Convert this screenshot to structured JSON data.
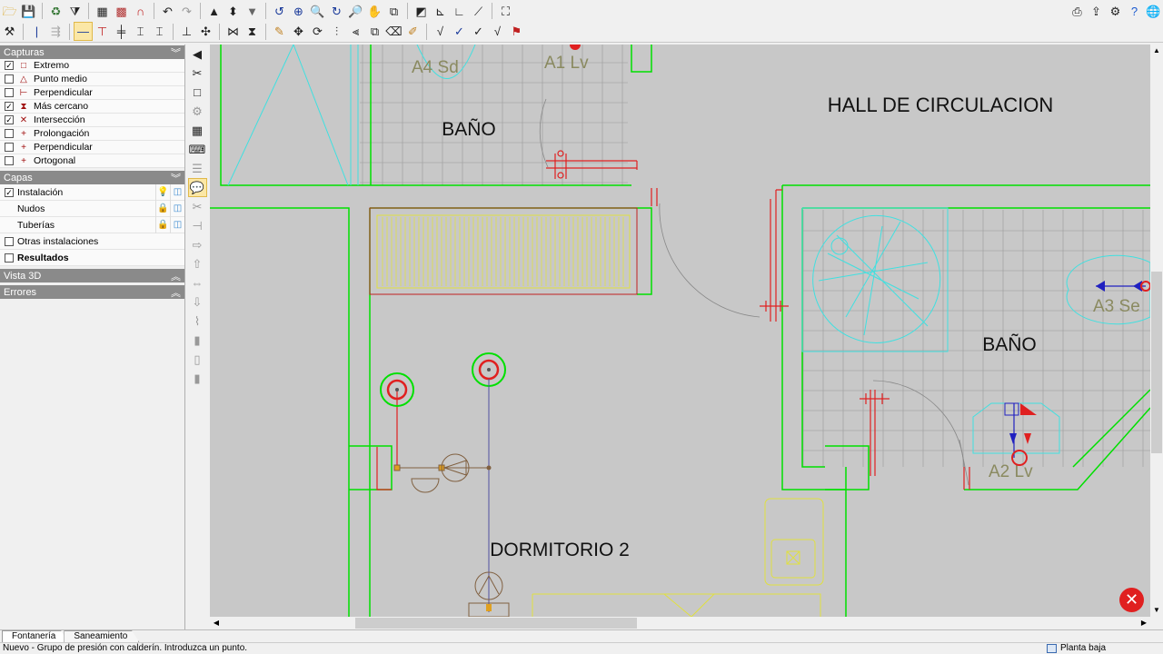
{
  "toolbar1": {
    "icons": [
      "open-folder-icon",
      "save-icon",
      "clean-icon",
      "filter-icon",
      "table-icon",
      "grid-icon",
      "magnet-icon",
      "undo-icon",
      "redo-icon",
      "move-up-icon",
      "level-icon",
      "dropdown-icon",
      "zoom-previous-icon",
      "zoom-window-icon",
      "zoom-icon",
      "zoom-realtime-icon",
      "zoom-extents-icon",
      "pan-icon",
      "zoom-all-icon",
      "measure-icon",
      "dimension-icon",
      "angle-icon",
      "binoculars-icon"
    ],
    "right_icons": [
      "printer-icon",
      "export-icon",
      "options-icon",
      "help-icon",
      "globe-icon"
    ]
  },
  "panel": {
    "capturas": {
      "title": "Capturas",
      "items": [
        {
          "label": "Extremo",
          "checked": true,
          "icon": "□"
        },
        {
          "label": "Punto medio",
          "checked": false,
          "icon": "△"
        },
        {
          "label": "Perpendicular",
          "checked": false,
          "icon": "⊢"
        },
        {
          "label": "Más cercano",
          "checked": true,
          "icon": "⧗"
        },
        {
          "label": "Intersección",
          "checked": true,
          "icon": "✕"
        },
        {
          "label": "Prolongación",
          "checked": false,
          "icon": "+"
        },
        {
          "label": "Perpendicular",
          "checked": false,
          "icon": "+"
        },
        {
          "label": "Ortogonal",
          "checked": false,
          "icon": "+"
        }
      ]
    },
    "capas": {
      "title": "Capas",
      "items": [
        {
          "label": "Instalación",
          "checked": true
        },
        {
          "label": "Nudos"
        },
        {
          "label": "Tuberías"
        },
        {
          "label": "Otras instalaciones",
          "checked": false
        },
        {
          "label": "Resultados",
          "checked": false
        }
      ]
    },
    "vista3d": {
      "title": "Vista 3D"
    },
    "errores": {
      "title": "Errores"
    }
  },
  "plan": {
    "rooms": {
      "bano_1": "BAÑO",
      "hall": "HALL DE CIRCULACION",
      "bano_2": "BAÑO",
      "dormitorio": "DORMITORIO 2"
    },
    "fixtures": {
      "a4": "A4  Sd",
      "a1": "A1  Lv",
      "a3": "A3  Se",
      "a2": "A2  Lv"
    }
  },
  "tabs": [
    {
      "label": "Fontanería",
      "selected": true
    },
    {
      "label": "Saneamiento",
      "selected": false
    }
  ],
  "status": {
    "message": "Nuevo - Grupo de presión con calderín.  Introduzca un punto.",
    "floor": "Planta baja"
  },
  "colors": {
    "canvas": "#c8c8c8",
    "wall": "#00e000",
    "fixture": "#40e0e0",
    "pipe": "#e02020",
    "furniture": "#e0e040"
  }
}
